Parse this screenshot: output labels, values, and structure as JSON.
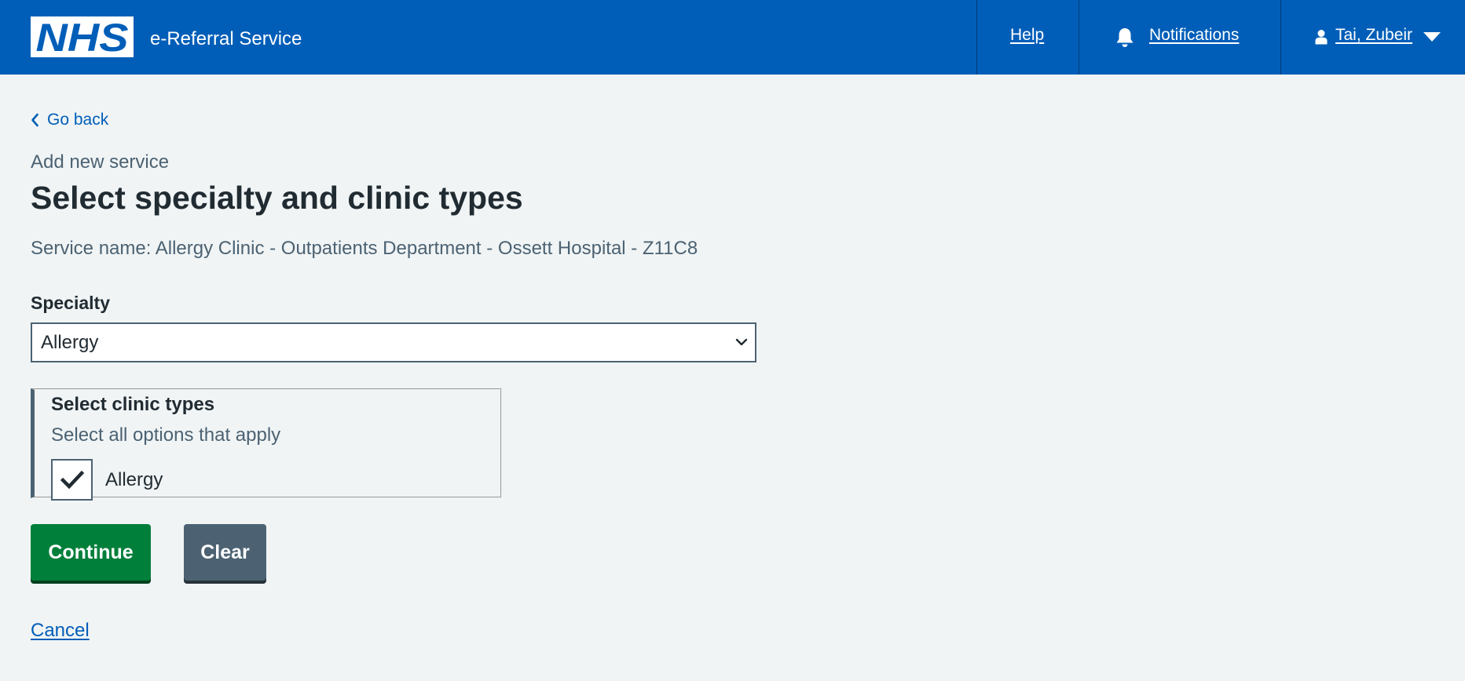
{
  "header": {
    "logo_text": "NHS",
    "service_name": "e-Referral Service",
    "nav": {
      "help": "Help",
      "notifications": "Notifications",
      "user": "Tai, Zubeir"
    }
  },
  "back_link": "Go back",
  "caption": "Add new service",
  "title": "Select specialty and clinic types",
  "service_line": "Service name: Allergy Clinic - Outpatients Department - Ossett Hospital - Z11C8",
  "specialty": {
    "label": "Specialty",
    "selected": "Allergy"
  },
  "clinic_types": {
    "legend": "Select clinic types",
    "hint": "Select all options that apply",
    "options": [
      {
        "label": "Allergy",
        "checked": true
      }
    ]
  },
  "buttons": {
    "continue": "Continue",
    "clear": "Clear"
  },
  "cancel": "Cancel",
  "colors": {
    "header_blue": "#005eb8",
    "page_bg": "#f0f4f5",
    "continue_green": "#007f3b",
    "secondary_grey": "#4c6272",
    "text": "#212b32"
  },
  "icons": {
    "back": "chevron-left-icon",
    "notifications": "bell-icon",
    "user": "user-icon",
    "user_menu": "caret-down-icon",
    "select": "chevron-down-icon",
    "checkbox": "checkmark-icon"
  }
}
